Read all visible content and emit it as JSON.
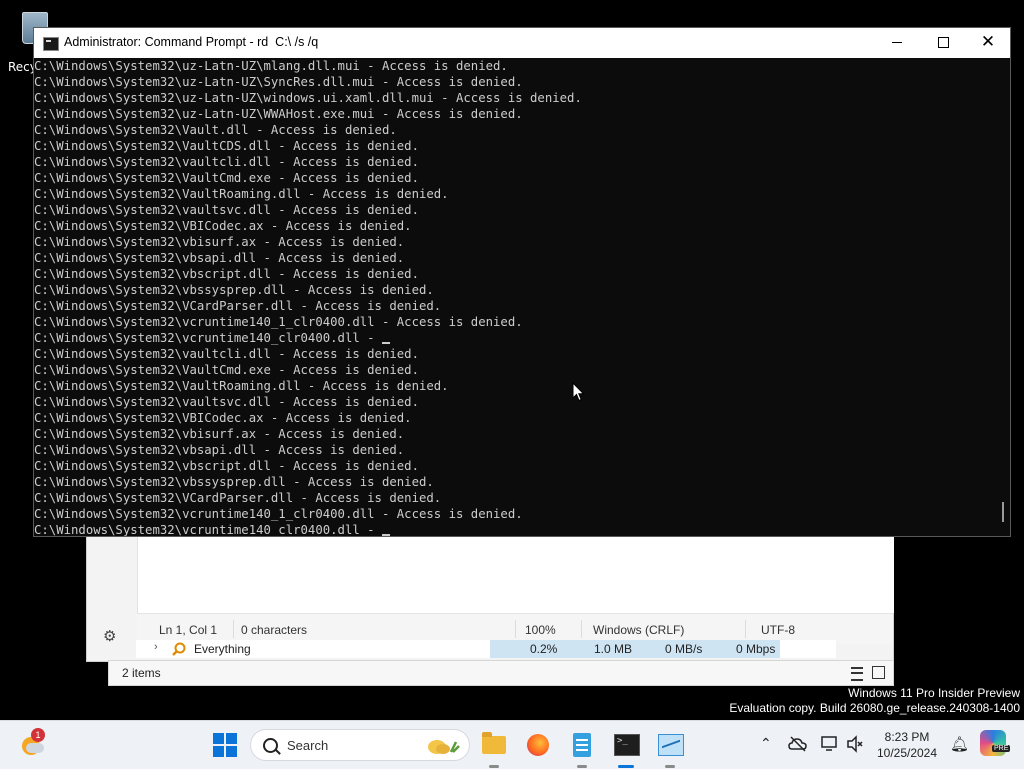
{
  "desktop": {
    "recycle_bin_label": "Recy"
  },
  "cmd_window": {
    "title": "Administrator: Command Prompt - rd  C:\\ /s /q",
    "lines": [
      "C:\\Windows\\System32\\uz-Latn-UZ\\mlang.dll.mui - Access is denied.",
      "C:\\Windows\\System32\\uz-Latn-UZ\\SyncRes.dll.mui - Access is denied.",
      "C:\\Windows\\System32\\uz-Latn-UZ\\windows.ui.xaml.dll.mui - Access is denied.",
      "C:\\Windows\\System32\\uz-Latn-UZ\\WWAHost.exe.mui - Access is denied.",
      "C:\\Windows\\System32\\Vault.dll - Access is denied.",
      "C:\\Windows\\System32\\VaultCDS.dll - Access is denied.",
      "C:\\Windows\\System32\\vaultcli.dll - Access is denied.",
      "C:\\Windows\\System32\\VaultCmd.exe - Access is denied.",
      "C:\\Windows\\System32\\VaultRoaming.dll - Access is denied.",
      "C:\\Windows\\System32\\vaultsvc.dll - Access is denied.",
      "C:\\Windows\\System32\\VBICodec.ax - Access is denied.",
      "C:\\Windows\\System32\\vbisurf.ax - Access is denied.",
      "C:\\Windows\\System32\\vbsapi.dll - Access is denied.",
      "C:\\Windows\\System32\\vbscript.dll - Access is denied.",
      "C:\\Windows\\System32\\vbssysprep.dll - Access is denied.",
      "C:\\Windows\\System32\\VCardParser.dll - Access is denied.",
      "C:\\Windows\\System32\\vcruntime140_1_clr0400.dll - Access is denied.",
      "C:\\Windows\\System32\\vcruntime140_clr0400.dll - ",
      "C:\\Windows\\System32\\vaultcli.dll - Access is denied.",
      "C:\\Windows\\System32\\VaultCmd.exe - Access is denied.",
      "C:\\Windows\\System32\\VaultRoaming.dll - Access is denied.",
      "C:\\Windows\\System32\\vaultsvc.dll - Access is denied.",
      "C:\\Windows\\System32\\VBICodec.ax - Access is denied.",
      "C:\\Windows\\System32\\vbisurf.ax - Access is denied.",
      "C:\\Windows\\System32\\vbsapi.dll - Access is denied.",
      "C:\\Windows\\System32\\vbscript.dll - Access is denied.",
      "C:\\Windows\\System32\\vbssysprep.dll - Access is denied.",
      "C:\\Windows\\System32\\VCardParser.dll - Access is denied.",
      "C:\\Windows\\System32\\vcruntime140_1_clr0400.dll - Access is denied.",
      "C:\\Windows\\System32\\vcruntime140_clr0400.dll - "
    ]
  },
  "notepad": {
    "status": {
      "position": "Ln 1, Col 1",
      "characters": "0 characters",
      "zoom": "100%",
      "line_ending": "Windows (CRLF)",
      "encoding": "UTF-8"
    }
  },
  "task_manager_row": {
    "name": "Everything",
    "cpu": "0.2%",
    "memory": "1.0 MB",
    "disk": "0 MB/s",
    "network": "0 Mbps"
  },
  "explorer": {
    "item_count": "2 items"
  },
  "watermark": {
    "line1": "Windows 11 Pro Insider Preview",
    "line2": "Evaluation copy. Build 26080.ge_release.240308-1400"
  },
  "taskbar": {
    "weather_badge": "1",
    "search_placeholder": "Search",
    "time": "8:23 PM",
    "date": "10/25/2024",
    "copilot_badge": "PRE"
  },
  "colors": {
    "console_bg": "#0c0c0c",
    "console_text": "#cccccc",
    "taskbar_bg": "#eef1f6",
    "accent": "#0a74d8"
  }
}
